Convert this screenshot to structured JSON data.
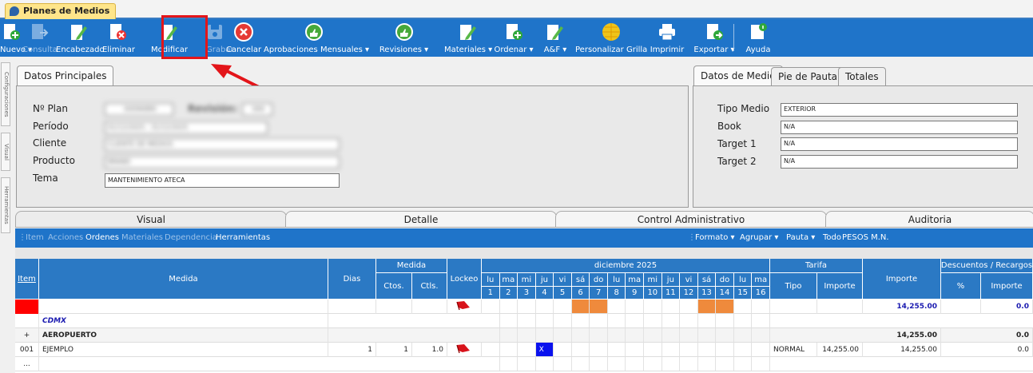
{
  "window": {
    "tab_title": "Planes de Medios"
  },
  "toolbar": {
    "buttons": [
      {
        "label": "Nuevo ▾",
        "icon": "add-document-icon",
        "disabled": false
      },
      {
        "label": "Consulta",
        "icon": "document-arrow-icon",
        "disabled": true
      },
      {
        "label": "Encabezado",
        "icon": "edit-document-icon",
        "disabled": false
      },
      {
        "label": "Eliminar",
        "icon": "delete-document-icon",
        "disabled": false
      },
      {
        "label": "Modificar",
        "icon": "edit-pencil-icon",
        "disabled": false
      },
      {
        "label": "Grabar",
        "icon": "save-icon",
        "disabled": true
      },
      {
        "label": "Cancelar",
        "icon": "cancel-icon",
        "disabled": false
      },
      {
        "label": "Aprobaciones Mensuales ▾",
        "icon": "thumbs-up-icon",
        "disabled": false
      },
      {
        "label": "Revisiones ▾",
        "icon": "thumbs-up-icon",
        "disabled": false
      },
      {
        "label": "Materiales ▾",
        "icon": "edit-document-icon",
        "disabled": false
      },
      {
        "label": "Ordenar ▾",
        "icon": "add-document-icon",
        "disabled": false
      },
      {
        "label": "A&F ▾",
        "icon": "edit-document-icon",
        "disabled": false
      },
      {
        "label": "Personalizar Grilla",
        "icon": "grid-globe-icon",
        "disabled": false
      },
      {
        "label": "Imprimir",
        "icon": "printer-icon",
        "disabled": false
      },
      {
        "label": "Exportar ▾",
        "icon": "export-icon",
        "disabled": false
      },
      {
        "label": "Ayuda",
        "icon": "help-book-icon",
        "disabled": false
      }
    ]
  },
  "side_tabs": [
    "Configuraciones",
    "Visual",
    "Herramientas"
  ],
  "datos_principales": {
    "tab_label": "Datos Principales",
    "plan_label": "Nº Plan",
    "plan_value": "00096880",
    "revision_label": "Revisión:",
    "revision_value": "000",
    "periodo_label": "Período",
    "periodo_value": "01/12/2025 - 31/12/2025",
    "cliente_label": "Cliente",
    "cliente_value": "CLIENTE DE MEDIOS",
    "producto_label": "Producto",
    "producto_value": "BRAND",
    "tema_label": "Tema",
    "tema_value": "MANTENIMIENTO ATECA"
  },
  "datos_medio": {
    "tabs": [
      "Datos de Medio",
      "Pie de Pauta",
      "Totales"
    ],
    "tipo_medio_label": "Tipo Medio",
    "tipo_medio_value": "EXTERIOR",
    "book_label": "Book",
    "book_value": "N/A",
    "target1_label": "Target 1",
    "target1_value": "N/A",
    "target2_label": "Target 2",
    "target2_value": "N/A"
  },
  "section_tabs": [
    "Visual",
    "Detalle",
    "Control Administrativo",
    "Auditoria"
  ],
  "action_bar": {
    "left": [
      "Item",
      "Acciones",
      "Ordenes",
      "Materiales",
      "Dependencia",
      "Herramientas"
    ],
    "right": [
      "Formato ▾",
      "Agrupar ▾",
      "Pauta ▾",
      "Todo",
      "PESOS M.N."
    ]
  },
  "grid": {
    "headers": {
      "item": "Item",
      "medida": "Medida",
      "dias": "Dias",
      "medida_group": "Medida",
      "ctos": "Ctos.",
      "ctls": "Ctls.",
      "lockeo": "Lockeo",
      "month": "diciembre 2025",
      "tarifa_group": "Tarifa",
      "tipo": "Tipo",
      "importe_tarifa": "Importe",
      "importe": "Importe",
      "descuentos_group": "Descuentos / Recargos",
      "pct": "%",
      "importe_desc": "Importe"
    },
    "day_names": [
      "lu",
      "ma",
      "mi",
      "ju",
      "vi",
      "sá",
      "do",
      "lu",
      "ma",
      "mi",
      "ju",
      "vi",
      "sá",
      "do",
      "lu",
      "ma"
    ],
    "day_numbers": [
      "1",
      "2",
      "3",
      "4",
      "5",
      "6",
      "7",
      "8",
      "9",
      "10",
      "11",
      "12",
      "13",
      "14",
      "15",
      "16"
    ],
    "rows": {
      "total_importe": "14,255.00",
      "total_desc": "0.0",
      "group_label": "CDMX",
      "sub_expander": "+",
      "sub_label": "AEROPUERTO",
      "sub_importe": "14,255.00",
      "sub_desc": "0.0",
      "item_no": "001",
      "item_medida": "EJEMPLO",
      "item_dias": "1",
      "item_ctos": "1",
      "item_ctls": "1.0",
      "item_mark": "X",
      "item_tipo": "NORMAL",
      "item_tarifa_importe": "14,255.00",
      "item_importe": "14,255.00",
      "item_desc": "0.0",
      "more": "..."
    }
  },
  "colors": {
    "toolbar": "#1f74c9",
    "header": "#2b79c4",
    "orange": "#ef8a3c",
    "highlight": "#e3151a"
  }
}
